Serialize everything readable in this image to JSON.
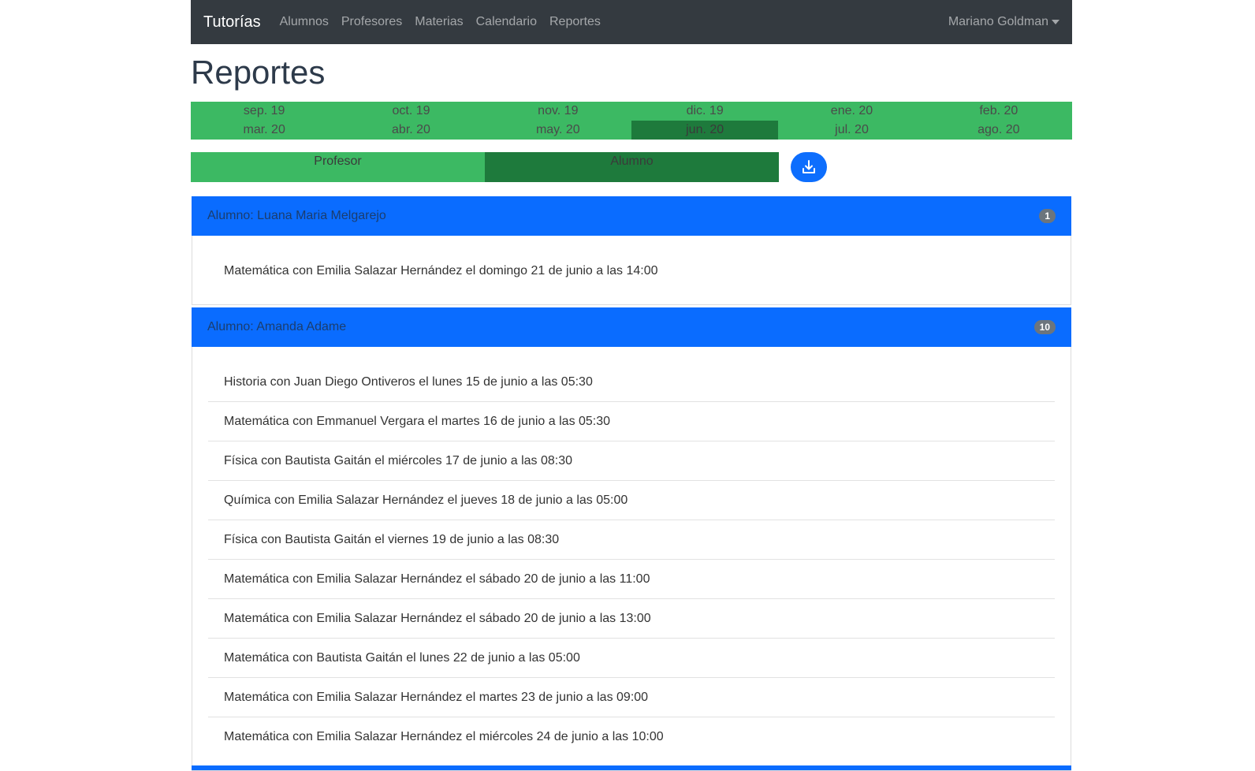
{
  "navbar": {
    "brand": "Tutorías",
    "links": [
      "Alumnos",
      "Profesores",
      "Materias",
      "Calendario",
      "Reportes"
    ],
    "user": "Mariano Goldman"
  },
  "page": {
    "title": "Reportes"
  },
  "months": [
    [
      "sep. 19",
      "oct. 19",
      "nov. 19",
      "dic. 19",
      "ene. 20",
      "feb. 20"
    ],
    [
      "mar. 20",
      "abr. 20",
      "may. 20",
      "jun. 20",
      "jul. 20",
      "ago. 20"
    ]
  ],
  "active_month": "jun. 20",
  "toggle": {
    "profesor": "Profesor",
    "alumno": "Alumno",
    "active": "alumno"
  },
  "download_icon": "download-icon",
  "groups": [
    {
      "title": "Alumno: Luana Maria Melgarejo",
      "count": "1",
      "items": [
        "Matemática con Emilia Salazar Hernández el domingo 21 de junio a las 14:00"
      ]
    },
    {
      "title": "Alumno: Amanda Adame",
      "count": "10",
      "items": [
        "Historia con Juan Diego Ontiveros el lunes 15 de junio a las 05:30",
        "Matemática con Emmanuel Vergara el martes 16 de junio a las 05:30",
        "Física con Bautista Gaitán el miércoles 17 de junio a las 08:30",
        "Química con Emilia Salazar Hernández el jueves 18 de junio a las 05:00",
        "Física con Bautista Gaitán el viernes 19 de junio a las 08:30",
        "Matemática con Emilia Salazar Hernández el sábado 20 de junio a las 11:00",
        "Matemática con Emilia Salazar Hernández el sábado 20 de junio a las 13:00",
        "Matemática con Bautista Gaitán el lunes 22 de junio a las 05:00",
        "Matemática con Emilia Salazar Hernández el martes 23 de junio a las 09:00",
        "Matemática con Emilia Salazar Hernández el miércoles 24 de junio a las 10:00"
      ]
    }
  ],
  "colors": {
    "navbar": "#343a40",
    "month_bar": "#3cb963",
    "month_active": "#1e7a3c",
    "card_header": "#0a6cff",
    "download_button": "#0d6efd"
  }
}
